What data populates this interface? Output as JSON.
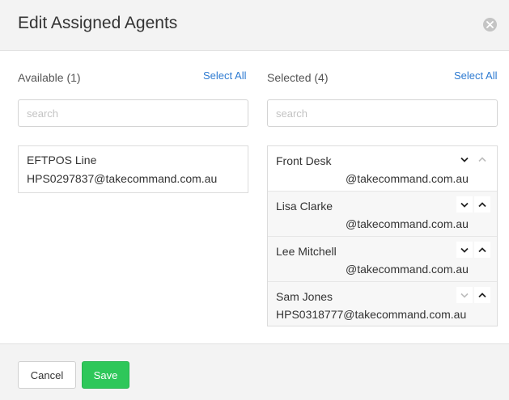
{
  "dialog": {
    "title": "Edit Assigned Agents"
  },
  "available": {
    "heading": "Available (1)",
    "select_all": "Select All",
    "search_placeholder": "search",
    "items": [
      {
        "name": "EFTPOS Line",
        "email": "HPS0297837@takecommand.com.au"
      }
    ]
  },
  "selected": {
    "heading": "Selected (4)",
    "select_all": "Select All",
    "search_placeholder": "search",
    "items": [
      {
        "name": "Front Desk",
        "email": "@takecommand.com.au"
      },
      {
        "name": "Lisa Clarke",
        "email": "@takecommand.com.au"
      },
      {
        "name": "Lee Mitchell",
        "email": "@takecommand.com.au"
      },
      {
        "name": "Sam Jones",
        "email": "HPS0318777@takecommand.com.au"
      }
    ]
  },
  "footer": {
    "cancel_label": "Cancel",
    "save_label": "Save"
  },
  "colors": {
    "link": "#2e7bd1",
    "save": "#2ec75a",
    "header_bg": "#f3f3f3"
  },
  "icons": {
    "close": "close-icon",
    "move_down": "chevron-down-icon",
    "move_up": "chevron-up-icon"
  }
}
